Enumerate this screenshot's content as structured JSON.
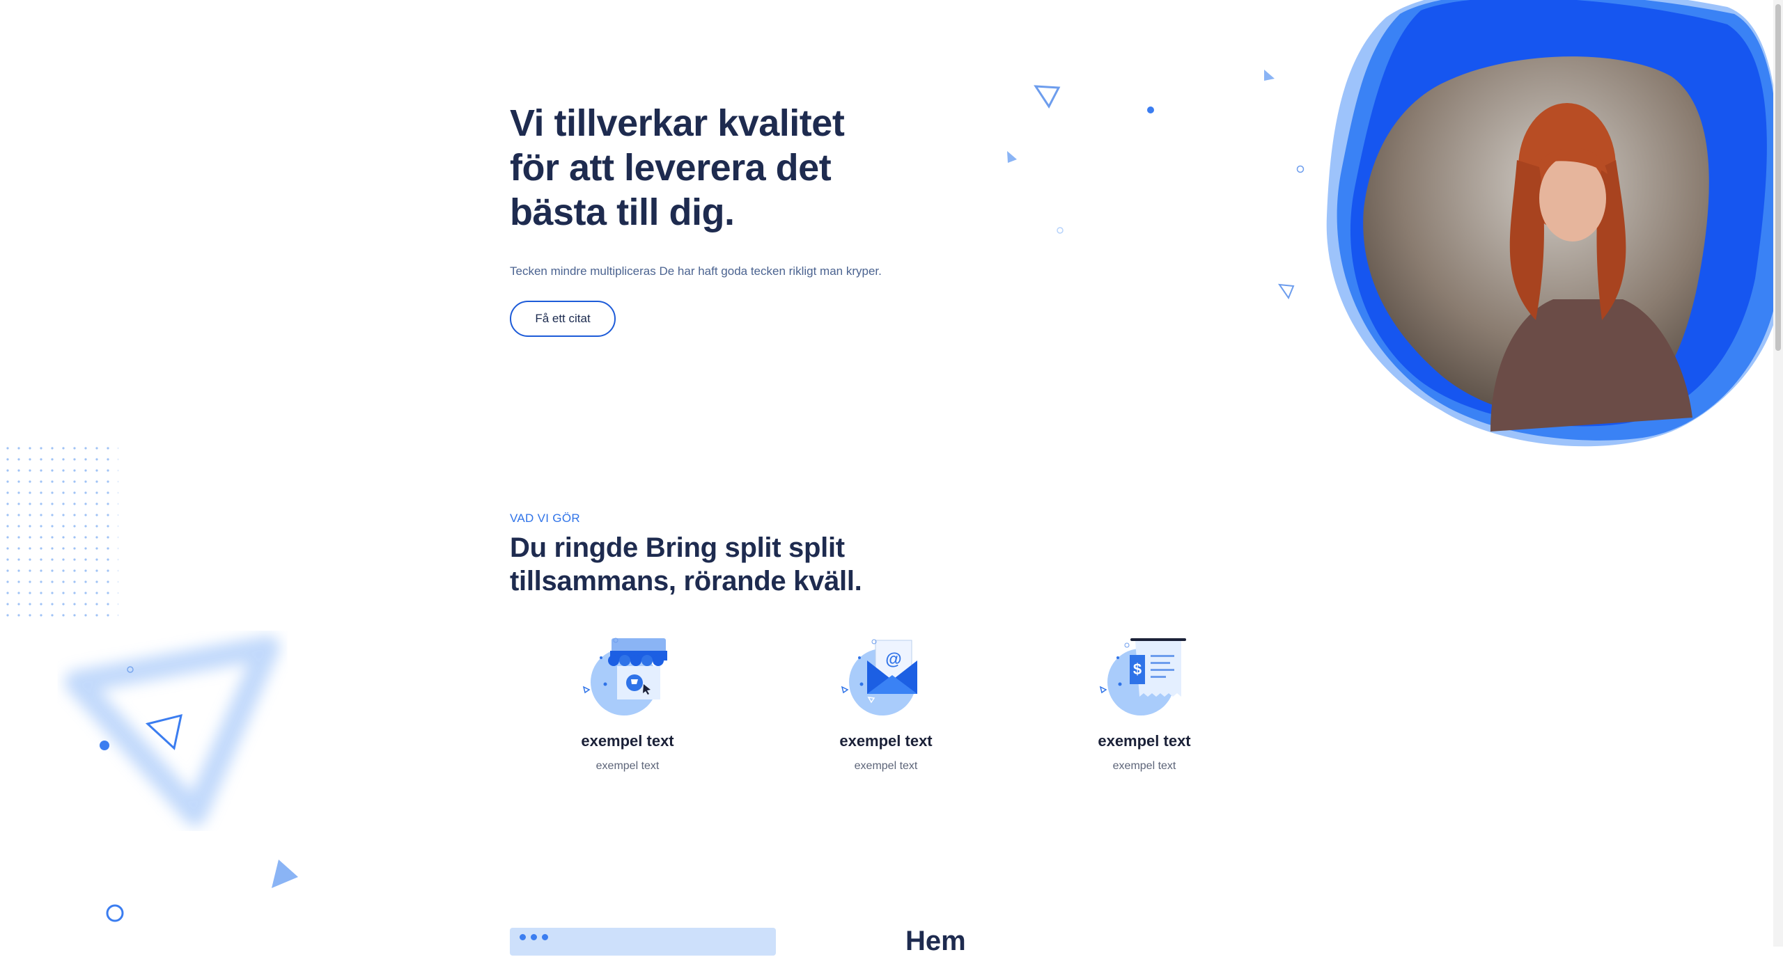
{
  "hero": {
    "title_lines": [
      "Vi tillverkar kvalitet",
      "för att leverera det",
      "bästa till dig."
    ],
    "subtitle": "Tecken mindre multipliceras De har haft goda tecken rikligt man kryper.",
    "cta_label": "Få ett citat"
  },
  "services": {
    "eyebrow": "VAD VI GÖR",
    "title_lines": [
      "Du ringde Bring split split",
      "tillsammans, rörande kväll."
    ],
    "items": [
      {
        "icon": "storefront-icon",
        "title": "exempel text",
        "text": "exempel text"
      },
      {
        "icon": "email-icon",
        "title": "exempel text",
        "text": "exempel text"
      },
      {
        "icon": "invoice-icon",
        "title": "exempel text",
        "text": "exempel text"
      }
    ]
  },
  "next_section": {
    "heading": "Hem"
  },
  "colors": {
    "accent": "#1d5bd8",
    "heading": "#1e2b4f",
    "blob": "#1656f0",
    "eyebrow": "#2f73e8"
  }
}
